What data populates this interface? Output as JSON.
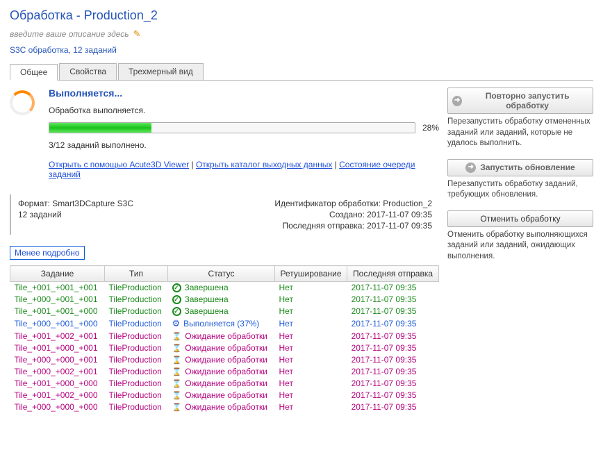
{
  "header": {
    "title": "Обработка - Production_2",
    "desc_placeholder": "введите ваше описание здесь",
    "subtitle": "S3C обработка, 12 заданий"
  },
  "tabs": {
    "general": "Общее",
    "properties": "Свойства",
    "view3d": "Трехмерный вид"
  },
  "status": {
    "title": "Выполняется...",
    "line": "Обработка выполняется.",
    "percent": "28%",
    "percent_value": 28,
    "progress_note": "3/12 заданий выполнено.",
    "links": {
      "open_viewer": "Открыть с помощью Acute3D Viewer",
      "open_output": "Открыть каталог выходных данных",
      "queue_state": "Состояние очереди заданий"
    },
    "separator": " | "
  },
  "meta": {
    "left": {
      "format": "Формат: Smart3DCapture S3C",
      "jobs": "12 заданий"
    },
    "right": {
      "id": "Идентификатор обработки: Production_2",
      "created": "Создано: 2017-11-07 09:35",
      "last_send": "Последняя отправка: 2017-11-07 09:35"
    }
  },
  "less_btn": "Менее подробно",
  "table": {
    "columns": {
      "task": "Задание",
      "type": "Тип",
      "status": "Статус",
      "retouch": "Ретуширование",
      "last_send": "Последняя отправка"
    },
    "rows": [
      {
        "task": "Tile_+001_+001_+001",
        "type": "TileProduction",
        "status": "Завершена",
        "retouch": "Нет",
        "last": "2017-11-07 09:35",
        "kind": "done"
      },
      {
        "task": "Tile_+000_+001_+001",
        "type": "TileProduction",
        "status": "Завершена",
        "retouch": "Нет",
        "last": "2017-11-07 09:35",
        "kind": "done"
      },
      {
        "task": "Tile_+001_+001_+000",
        "type": "TileProduction",
        "status": "Завершена",
        "retouch": "Нет",
        "last": "2017-11-07 09:35",
        "kind": "done"
      },
      {
        "task": "Tile_+000_+001_+000",
        "type": "TileProduction",
        "status": "Выполняется (37%)",
        "retouch": "Нет",
        "last": "2017-11-07 09:35",
        "kind": "run"
      },
      {
        "task": "Tile_+001_+002_+001",
        "type": "TileProduction",
        "status": "Ожидание обработки",
        "retouch": "Нет",
        "last": "2017-11-07 09:35",
        "kind": "wait"
      },
      {
        "task": "Tile_+001_+000_+001",
        "type": "TileProduction",
        "status": "Ожидание обработки",
        "retouch": "Нет",
        "last": "2017-11-07 09:35",
        "kind": "wait"
      },
      {
        "task": "Tile_+000_+000_+001",
        "type": "TileProduction",
        "status": "Ожидание обработки",
        "retouch": "Нет",
        "last": "2017-11-07 09:35",
        "kind": "wait"
      },
      {
        "task": "Tile_+000_+002_+001",
        "type": "TileProduction",
        "status": "Ожидание обработки",
        "retouch": "Нет",
        "last": "2017-11-07 09:35",
        "kind": "wait"
      },
      {
        "task": "Tile_+001_+000_+000",
        "type": "TileProduction",
        "status": "Ожидание обработки",
        "retouch": "Нет",
        "last": "2017-11-07 09:35",
        "kind": "wait"
      },
      {
        "task": "Tile_+001_+002_+000",
        "type": "TileProduction",
        "status": "Ожидание обработки",
        "retouch": "Нет",
        "last": "2017-11-07 09:35",
        "kind": "wait"
      },
      {
        "task": "Tile_+000_+000_+000",
        "type": "TileProduction",
        "status": "Ожидание обработки",
        "retouch": "Нет",
        "last": "2017-11-07 09:35",
        "kind": "wait"
      }
    ]
  },
  "side": {
    "restart": {
      "label": "Повторно запустить обработку",
      "desc": "Перезапустить обработку отмененных заданий или заданий, которые не удалось выполнить."
    },
    "update": {
      "label": "Запустить обновление",
      "desc": "Перезапустить обработку заданий, требующих обновления."
    },
    "cancel": {
      "label": "Отменить обработку",
      "desc": "Отменить обработку выполняющихся заданий или заданий, ожидающих выполнения."
    }
  }
}
